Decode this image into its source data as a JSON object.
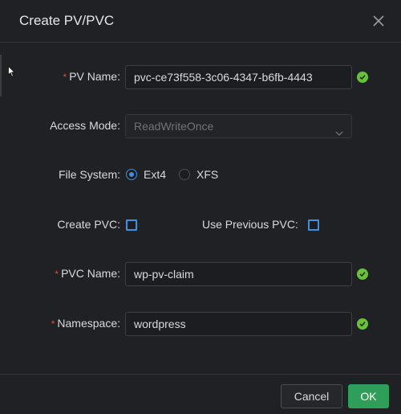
{
  "dialog": {
    "title": "Create PV/PVC",
    "close_icon": "close-icon"
  },
  "form": {
    "pv_name": {
      "label": "PV Name:",
      "required": "*",
      "value": "pvc-ce73f558-3c06-4347-b6fb-4443",
      "valid": true
    },
    "access_mode": {
      "label": "Access Mode:",
      "value": "ReadWriteOnce",
      "disabled": true
    },
    "file_system": {
      "label": "File System:",
      "options": [
        "Ext4",
        "XFS"
      ],
      "selected": "Ext4"
    },
    "create_pvc": {
      "label": "Create PVC:",
      "checked": false
    },
    "use_previous_pvc": {
      "label": "Use Previous PVC:",
      "checked": false
    },
    "pvc_name": {
      "label": "PVC Name:",
      "required": "*",
      "value": "wp-pv-claim",
      "valid": true
    },
    "namespace": {
      "label": "Namespace:",
      "required": "*",
      "value": "wordpress",
      "valid": true
    }
  },
  "footer": {
    "cancel_label": "Cancel",
    "ok_label": "OK"
  },
  "colors": {
    "accent": "#3d8fe0",
    "success": "#67c23a",
    "ok_button": "#2e9e58",
    "required": "#e0474c"
  }
}
